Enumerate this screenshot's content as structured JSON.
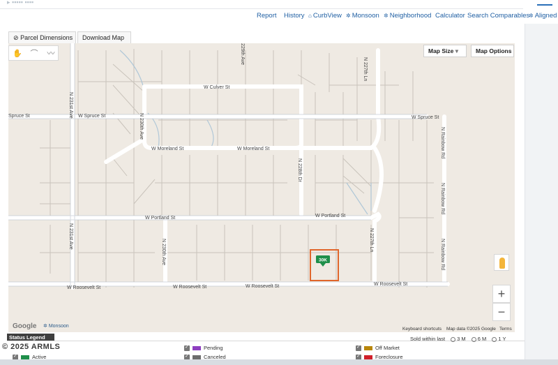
{
  "header": {
    "ghost_text": "▸ ▪▪▪▪▪ ▪▪▪▪",
    "links": [
      {
        "label": "Report",
        "icon": ""
      },
      {
        "label": "History",
        "icon": ""
      },
      {
        "label": "CurbView",
        "icon": "house-icon"
      },
      {
        "label": "Monsoon",
        "icon": "storm-icon"
      },
      {
        "label": "Neighborhood",
        "icon": "storm-icon"
      },
      {
        "label": "Calculator",
        "icon": ""
      },
      {
        "label": "Search Comparables",
        "icon": ""
      },
      {
        "label": "Aligned",
        "icon": "storm-icon"
      }
    ]
  },
  "map_tabs": {
    "parcel": "Parcel Dimensions",
    "download": "Download Map"
  },
  "map_controls": {
    "size": "Map Size",
    "size_caret": "▾",
    "options": "Map Options",
    "zoom_in": "+",
    "zoom_out": "−"
  },
  "streets": {
    "culver": "W Culver St",
    "spruce_w": "Spruce St",
    "spruce_mid": "W Spruce St",
    "spruce_e": "W Spruce St",
    "moreland_w": "W Moreland St",
    "moreland_e": "W Moreland St",
    "portland_w": "W Portland St",
    "portland_e": "W Portland St",
    "roosevelt_1": "W Roosevelt St",
    "roosevelt_2": "W Roosevelt St",
    "roosevelt_3": "W Roosevelt St",
    "roosevelt_4": "W Roosevelt St",
    "ave_231": "N 231st Ave",
    "ave_231b": "N 231st Ave",
    "ave_230": "N 230th Ave",
    "ave_230b": "N 230th Ave",
    "ave_229": "229th Ave",
    "dr_228": "N 228th Dr",
    "ln_227": "N 227th Ln",
    "ln_227b": "N 227th Ln",
    "rainbow_1": "N Rainbow Rd",
    "rainbow_2": "N Rainbow Rd",
    "rainbow_3": "N Rainbow Rd"
  },
  "marker": {
    "label": "30K",
    "color": "#1e8f4a",
    "parcel_outline": "#e0662b"
  },
  "attribution": {
    "google": "Google",
    "monsoon": "Monsoon",
    "shortcuts": "Keyboard shortcuts",
    "mapdata": "Map data ©2025 Google",
    "terms": "Terms"
  },
  "legend": {
    "title": "Status Legend",
    "copyright": "2025 ARMLS",
    "items": [
      {
        "label": "Active",
        "color": "#1e8f4a"
      },
      {
        "label": "Pending",
        "color": "#8e3fc0"
      },
      {
        "label": "Canceled",
        "color": "#6d6d6d"
      },
      {
        "label": "Off Market",
        "color": "#b8860b"
      },
      {
        "label": "Foreclosure",
        "color": "#d0202a"
      }
    ],
    "sold_within": "Sold within last",
    "sold_options": [
      "3 M",
      "6 M",
      "1 Y"
    ]
  }
}
